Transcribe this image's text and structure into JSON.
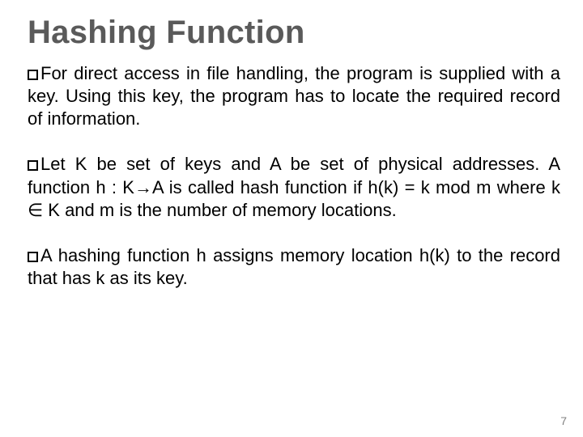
{
  "title": "Hashing Function",
  "paragraphs": {
    "p1_lead": "For",
    "p1_rest": " direct access in file handling, the program is supplied with a key. Using this key, the program has to locate the required record of information.",
    "p2_lead": "Let",
    "p2_rest_a": " K be set of keys and A be set of physical addresses.  A function  h : K",
    "p2_arrow": "→",
    "p2_rest_b": "A  is called hash function if   h(k) = k mod m   where k ",
    "p2_in": "∈",
    "p2_rest_c": " K  and m is the number of memory locations.",
    "p3_lead": "A",
    "p3_rest": " hashing function h assigns memory location h(k) to the record that has  k  as its key."
  },
  "page_number": "7"
}
